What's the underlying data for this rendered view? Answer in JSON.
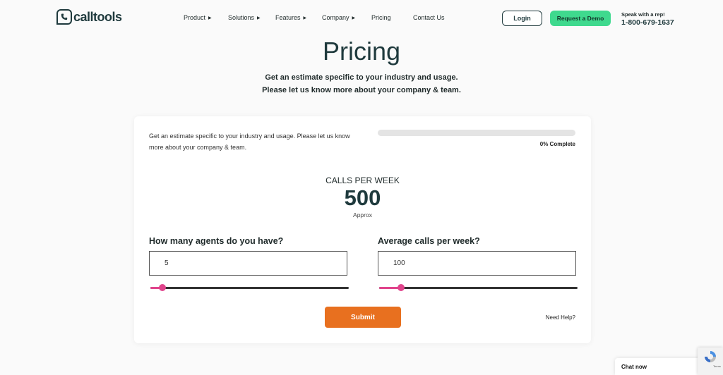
{
  "brand": {
    "name": "calltools"
  },
  "nav": {
    "items": [
      {
        "label": "Product",
        "has_menu": true
      },
      {
        "label": "Solutions",
        "has_menu": true
      },
      {
        "label": "Features",
        "has_menu": true
      },
      {
        "label": "Company",
        "has_menu": true
      },
      {
        "label": "Pricing",
        "has_menu": false
      },
      {
        "label": "Contact Us",
        "has_menu": false
      }
    ]
  },
  "header": {
    "login_label": "Login",
    "demo_label": "Request a Demo",
    "rep_label": "Speak with a rep!",
    "rep_phone": "1-800-679-1637"
  },
  "hero": {
    "title": "Pricing",
    "subtitle_line1": "Get an estimate specific to your industry and usage.",
    "subtitle_line2": "Please let us know more about your company & team."
  },
  "form": {
    "intro": "Get an estimate specific to your industry and usage. Please let us know more about your company & team.",
    "progress": {
      "percent": 0,
      "label": "0% Complete"
    },
    "calls": {
      "label": "CALLS PER WEEK",
      "value": "500",
      "note": "Approx"
    },
    "agents": {
      "label": "How many agents do you have?",
      "value": "5",
      "slider_fraction": 0.06
    },
    "avg_calls": {
      "label": "Average calls per week?",
      "value": "100",
      "slider_fraction": 0.11
    },
    "submit_label": "Submit",
    "help_label": "Need Help?"
  },
  "chat": {
    "label": "Chat now"
  },
  "recaptcha": {
    "terms": "Terms"
  },
  "colors": {
    "primary_dark": "#1f3a3d",
    "demo_green": "#3fd98e",
    "submit_orange": "#e8701f",
    "slider_pink": "#e0448c"
  }
}
